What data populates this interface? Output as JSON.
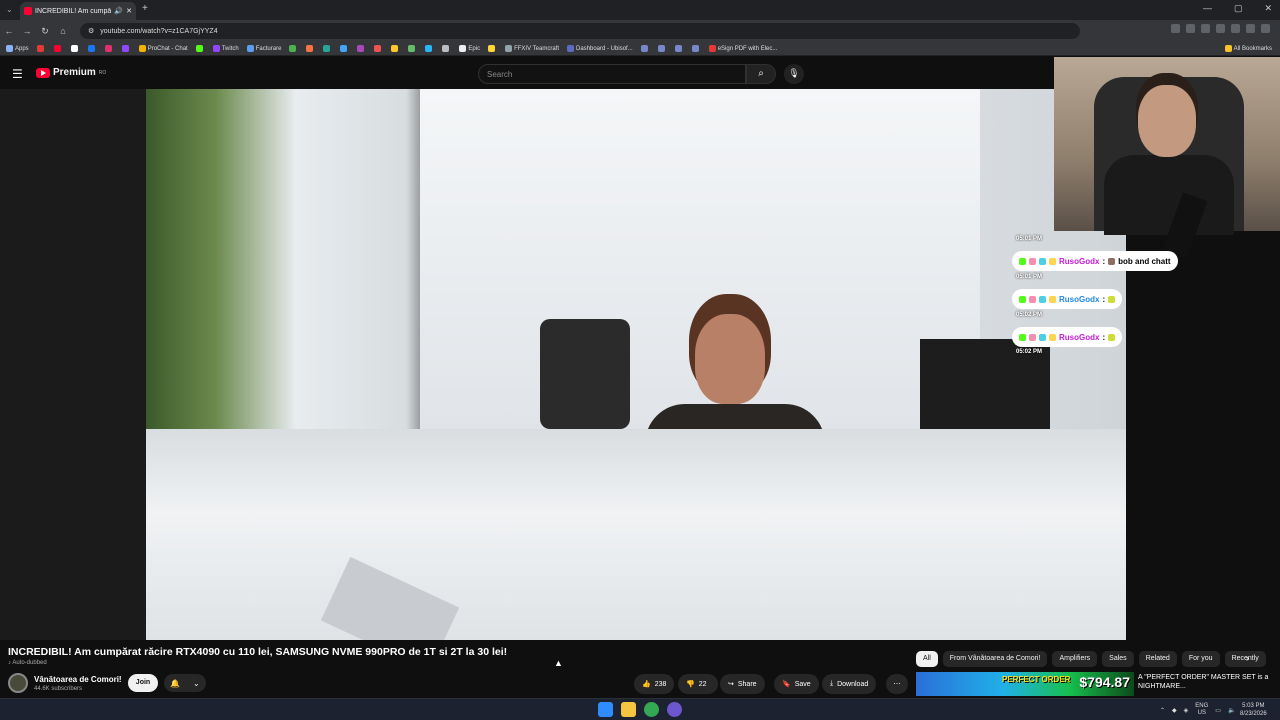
{
  "browser": {
    "tab_title": "INCREDIBIL! Am cumpărat r...",
    "url": "youtube.com/watch?v=z1CA7GjYYZ4",
    "window_controls": [
      "—",
      "▢",
      "✕"
    ],
    "bookmarks": [
      "Apps",
      "ProChat - Chat",
      "Twitch",
      "Facturare",
      "Epic",
      "FFXIV Teamcraft",
      "Dashboard - Ubisof...",
      "eSign PDF with Elec...",
      "All Bookmarks"
    ]
  },
  "youtube": {
    "logo_text": "Premium",
    "logo_region": "RO",
    "search_placeholder": "Search"
  },
  "stream_chat": [
    {
      "time": "05:01 PM",
      "user": "RusoGodx",
      "message": "bob and chatt"
    },
    {
      "time": "05:01 PM",
      "user": "RusoGodx",
      "message": ""
    },
    {
      "time": "05:02 PM",
      "user": "RusoGodx",
      "message": ""
    }
  ],
  "chat_trailing_time": "05:02 PM",
  "video": {
    "title": "INCREDIBIL! Am cumpărat răcire RTX4090 cu 110 lei, SAMSUNG NVME 990PRO de 1T si 2T la 30 lei!",
    "auto_dubbed": "Auto-dubbed",
    "channel_name": "Vânătoarea de Comori!",
    "subscribers": "44.6K subscribers",
    "join_label": "Join",
    "likes": "238",
    "dislikes": "22",
    "share_label": "Share",
    "save_label": "Save",
    "download_label": "Download"
  },
  "chips": [
    "All",
    "From Vânătoarea de Comori!",
    "Amplifiers",
    "Sales",
    "Related",
    "For you",
    "Recently"
  ],
  "recommendation": {
    "price_overlay": "$794.87",
    "brand_overlay": "PERFECT ORDER",
    "title": "A \"PERFECT ORDER\" MASTER SET is a NIGHTMARE..."
  },
  "taskbar": {
    "lang": "ENG",
    "region": "US",
    "time": "5:03 PM",
    "date": "8/23/2026"
  },
  "colors": {
    "yt_red": "#ff0033",
    "chat_name": "#c41bd6",
    "bg": "#0f0f0f"
  }
}
